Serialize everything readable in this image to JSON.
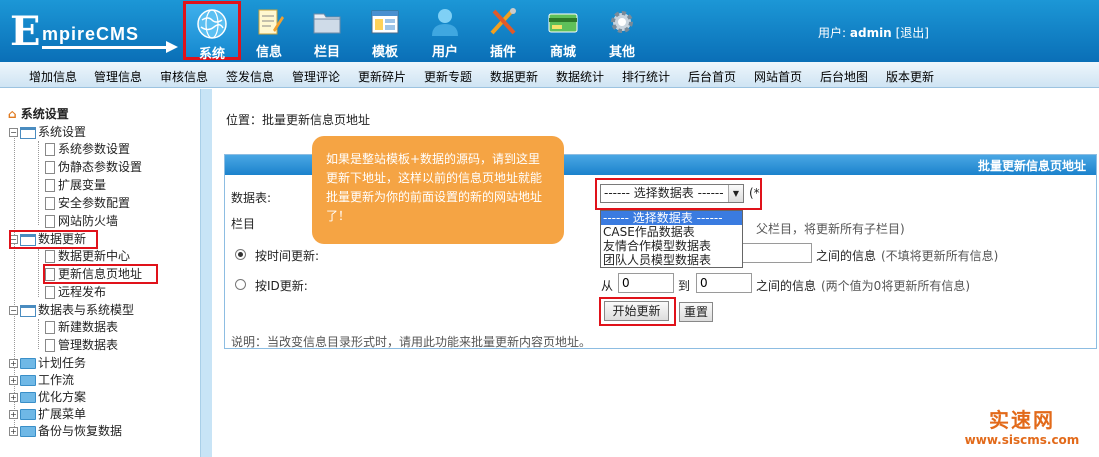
{
  "header": {
    "logo_text": "EmpireCMS",
    "logo_initial": "E",
    "logo_rest": "mpireCMS",
    "nav": [
      {
        "label": "系统",
        "icon": "globe-icon",
        "active": true
      },
      {
        "label": "信息",
        "icon": "notepad-icon"
      },
      {
        "label": "栏目",
        "icon": "folder-icon"
      },
      {
        "label": "模板",
        "icon": "window-icon"
      },
      {
        "label": "用户",
        "icon": "user-icon"
      },
      {
        "label": "插件",
        "icon": "tools-icon"
      },
      {
        "label": "商城",
        "icon": "card-icon"
      },
      {
        "label": "其他",
        "icon": "gear-icon"
      }
    ],
    "user_prefix": "用户:",
    "username": "admin",
    "logout": "[退出]"
  },
  "submenu": [
    "增加信息",
    "管理信息",
    "审核信息",
    "签发信息",
    "管理评论",
    "更新碎片",
    "更新专题",
    "数据更新",
    "数据统计",
    "排行统计",
    "后台首页",
    "网站首页",
    "后台地图",
    "版本更新"
  ],
  "sidebar": {
    "root": "系统设置",
    "groups": [
      {
        "label": "系统设置",
        "children": [
          "系统参数设置",
          "伪静态参数设置",
          "扩展变量",
          "安全参数配置",
          "网站防火墙"
        ]
      },
      {
        "label": "数据更新",
        "children": [
          "数据更新中心",
          "更新信息页地址",
          "远程发布"
        ]
      },
      {
        "label": "数据表与系统模型",
        "children": [
          "新建数据表",
          "管理数据表"
        ]
      }
    ],
    "collapsed": [
      "计划任务",
      "工作流",
      "优化方案",
      "扩展菜单",
      "备份与恢复数据"
    ]
  },
  "main": {
    "breadcrumb": "位置：批量更新信息页地址",
    "panel_title": "批量更新信息页地址",
    "table_label": "数据表:",
    "select_value": "------ 选择数据表 ------",
    "required_mark": "(*",
    "dropdown_options": [
      "------ 选择数据表 ------",
      "CASE作品数据表",
      "友情合作模型数据表",
      "团队人员模型数据表"
    ],
    "column_label": "栏目",
    "column_hint": "父栏目，将更新所有子栏目)",
    "time_update_label": "按时间更新:",
    "time_hint_prefix": "之间的信息",
    "time_hint": "(不填将更新所有信息)",
    "id_update_label": "按ID更新:",
    "from_label": "从",
    "from_value": "0",
    "to_label": "到",
    "to_value": "0",
    "id_hint_prefix": "之间的信息",
    "id_hint": "(两个值为0将更新所有信息)",
    "start_button": "开始更新",
    "reset_button": "重置",
    "note": "说明：当改变信息目录形式时，请用此功能来批量更新内容页地址。",
    "tooltip": "如果是整站模板+数据的源码，请到这里更新下地址，这样以前的信息页地址就能批量更新为你的前面设置的新的网站地址了！"
  },
  "watermark": {
    "title": "实速网",
    "url": "www.siscms.com"
  }
}
